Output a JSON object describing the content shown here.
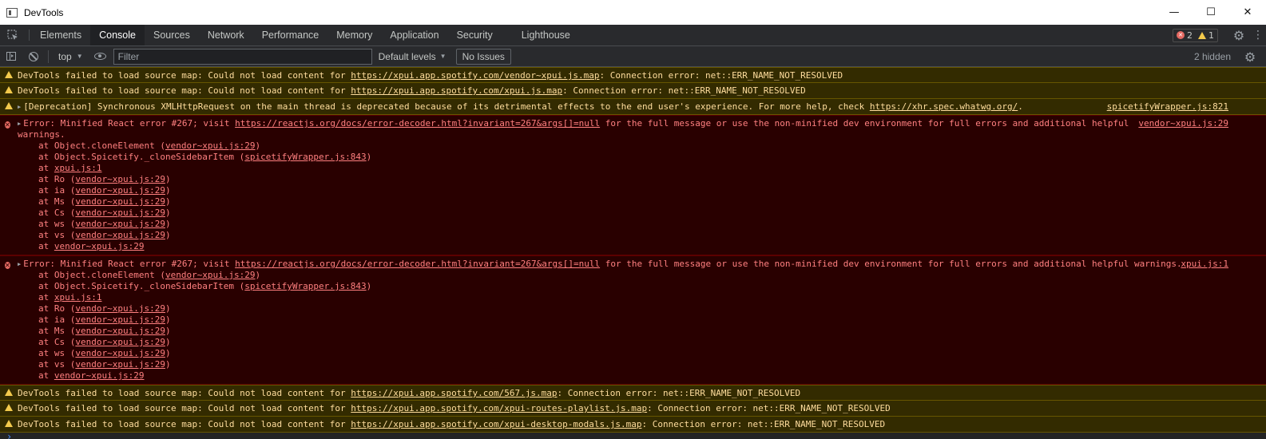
{
  "window": {
    "title": "DevTools",
    "minimize_glyph": "—",
    "maximize_glyph": "☐",
    "close_glyph": "✕"
  },
  "tabs": [
    {
      "label": "Elements"
    },
    {
      "label": "Console"
    },
    {
      "label": "Sources"
    },
    {
      "label": "Network"
    },
    {
      "label": "Performance"
    },
    {
      "label": "Memory"
    },
    {
      "label": "Application"
    },
    {
      "label": "Security"
    },
    {
      "label": "Lighthouse"
    }
  ],
  "active_tab": "Console",
  "issue_counter": {
    "errors": "2",
    "warnings": "1"
  },
  "toolbar": {
    "context": "top",
    "filter_placeholder": "Filter",
    "levels": "Default levels",
    "no_issues": "No Issues",
    "hidden": "2 hidden"
  },
  "icons": {
    "inspect": "inspect-element-icon",
    "settings": "gear-icon",
    "menu": "kebab-menu-icon",
    "sidebar": "sidebar-toggle-icon",
    "clear": "clear-console-icon",
    "eye": "live-expression-eye-icon",
    "warning": "warning-triangle-icon",
    "error": "error-circle-icon"
  },
  "colors": {
    "warning_bg": "#332b00",
    "warning_text": "#ffdd9e",
    "error_bg": "#290000",
    "error_text": "#ff8080",
    "error_icon": "#e46962",
    "warning_icon": "#f2c94c"
  },
  "messages": {
    "w1": {
      "pre": "DevTools failed to load source map: Could not load content for ",
      "link": "https://xpui.app.spotify.com/vendor~xpui.js.map",
      "post": ": Connection error: net::ERR_NAME_NOT_RESOLVED"
    },
    "w2": {
      "pre": "DevTools failed to load source map: Could not load content for ",
      "link": "https://xpui.app.spotify.com/xpui.js.map",
      "post": ": Connection error: net::ERR_NAME_NOT_RESOLVED"
    },
    "w3": {
      "pre": "[Deprecation] Synchronous XMLHttpRequest on the main thread is deprecated because of its detrimental effects to the end user's experience. For more help, check ",
      "link": "https://xhr.spec.whatwg.org/",
      "post": ".",
      "source": "spicetifyWrapper.js:821"
    },
    "e1": {
      "pre": "Error: Minified React error #267; visit ",
      "link": "https://reactjs.org/docs/error-decoder.html?invariant=267&args[]=null",
      "post_line1": " for the full message or use the non-minified dev environment for full errors and additional helpful",
      "post_line2": "warnings.",
      "source": "vendor~xpui.js:29",
      "stack": [
        {
          "pre": "at Object.cloneElement (",
          "link": "vendor~xpui.js:29",
          "post": ")"
        },
        {
          "pre": "at Object.Spicetify._cloneSidebarItem (",
          "link": "spicetifyWrapper.js:843",
          "post": ")"
        },
        {
          "pre": "at ",
          "link": "xpui.js:1",
          "post": ""
        },
        {
          "pre": "at Ro (",
          "link": "vendor~xpui.js:29",
          "post": ")"
        },
        {
          "pre": "at ia (",
          "link": "vendor~xpui.js:29",
          "post": ")"
        },
        {
          "pre": "at Ms (",
          "link": "vendor~xpui.js:29",
          "post": ")"
        },
        {
          "pre": "at Cs (",
          "link": "vendor~xpui.js:29",
          "post": ")"
        },
        {
          "pre": "at ws (",
          "link": "vendor~xpui.js:29",
          "post": ")"
        },
        {
          "pre": "at vs (",
          "link": "vendor~xpui.js:29",
          "post": ")"
        },
        {
          "pre": "at ",
          "link": "vendor~xpui.js:29",
          "post": ""
        }
      ]
    },
    "e2": {
      "pre": "Error: Minified React error #267; visit ",
      "link": "https://reactjs.org/docs/error-decoder.html?invariant=267&args[]=null",
      "post": " for the full message or use the non-minified dev environment for full errors and additional helpful warnings.",
      "source": "xpui.js:1",
      "stack": [
        {
          "pre": "at Object.cloneElement (",
          "link": "vendor~xpui.js:29",
          "post": ")"
        },
        {
          "pre": "at Object.Spicetify._cloneSidebarItem (",
          "link": "spicetifyWrapper.js:843",
          "post": ")"
        },
        {
          "pre": "at ",
          "link": "xpui.js:1",
          "post": ""
        },
        {
          "pre": "at Ro (",
          "link": "vendor~xpui.js:29",
          "post": ")"
        },
        {
          "pre": "at ia (",
          "link": "vendor~xpui.js:29",
          "post": ")"
        },
        {
          "pre": "at Ms (",
          "link": "vendor~xpui.js:29",
          "post": ")"
        },
        {
          "pre": "at Cs (",
          "link": "vendor~xpui.js:29",
          "post": ")"
        },
        {
          "pre": "at ws (",
          "link": "vendor~xpui.js:29",
          "post": ")"
        },
        {
          "pre": "at vs (",
          "link": "vendor~xpui.js:29",
          "post": ")"
        },
        {
          "pre": "at ",
          "link": "vendor~xpui.js:29",
          "post": ""
        }
      ]
    },
    "w4": {
      "pre": "DevTools failed to load source map: Could not load content for ",
      "link": "https://xpui.app.spotify.com/567.js.map",
      "post": ": Connection error: net::ERR_NAME_NOT_RESOLVED"
    },
    "w5": {
      "pre": "DevTools failed to load source map: Could not load content for ",
      "link": "https://xpui.app.spotify.com/xpui-routes-playlist.js.map",
      "post": ": Connection error: net::ERR_NAME_NOT_RESOLVED"
    },
    "w6": {
      "pre": "DevTools failed to load source map: Could not load content for ",
      "link": "https://xpui.app.spotify.com/xpui-desktop-modals.js.map",
      "post": ": Connection error: net::ERR_NAME_NOT_RESOLVED"
    }
  },
  "prompt_glyph": "›"
}
